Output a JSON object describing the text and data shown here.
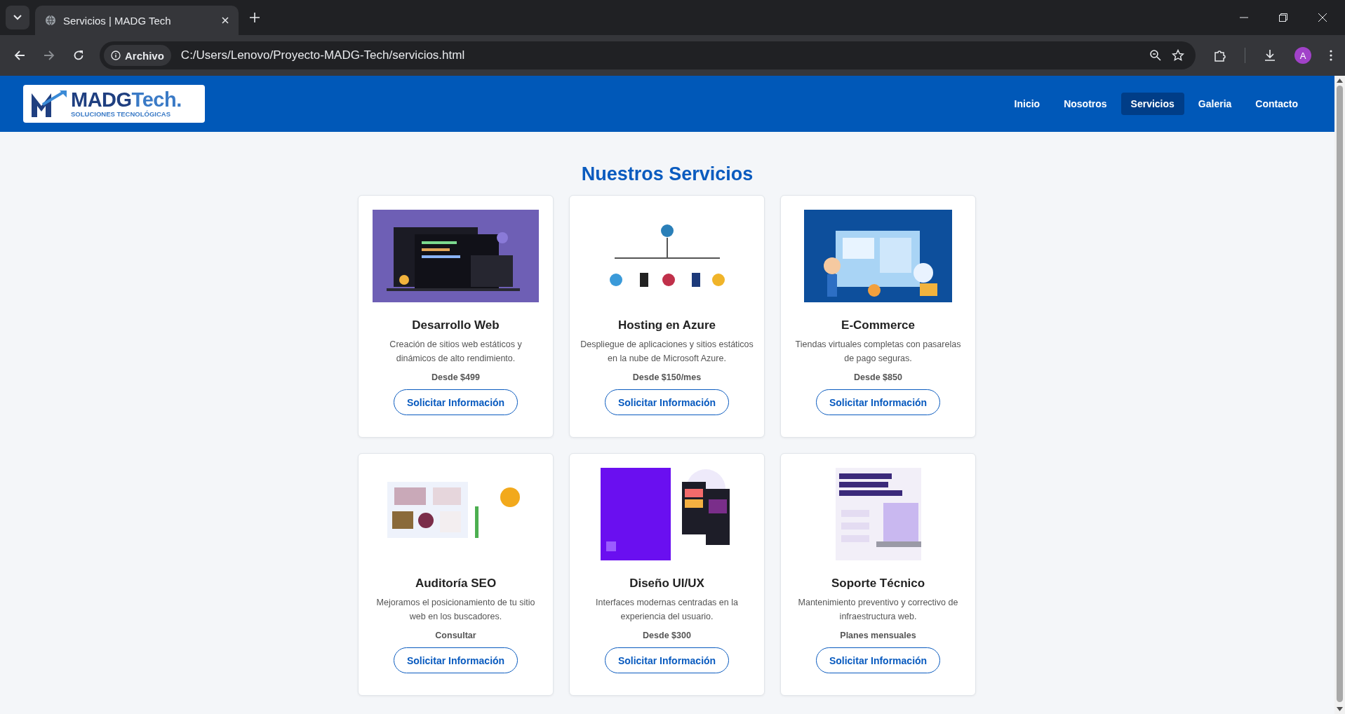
{
  "browser": {
    "tab_title": "Servicios | MADG Tech",
    "site_chip": "Archivo",
    "url": "C:/Users/Lenovo/Proyecto-MADG-Tech/servicios.html",
    "avatar": "A"
  },
  "site": {
    "logo": {
      "name": "MADG",
      "name_accent": "Tech.",
      "tagline": "SOLUCIONES TECNOLÓGICAS"
    },
    "nav": [
      {
        "label": "Inicio",
        "selected": false
      },
      {
        "label": "Nosotros",
        "selected": false
      },
      {
        "label": "Servicios",
        "selected": true
      },
      {
        "label": "Galeria",
        "selected": false
      },
      {
        "label": "Contacto",
        "selected": false
      }
    ]
  },
  "heading": "Nuestros Servicios",
  "services": [
    {
      "title": "Desarrollo Web",
      "description": "Creación de sitios web estáticos y dinámicos de alto rendimiento.",
      "price": "Desde $499",
      "button": "Solicitar Información"
    },
    {
      "title": "Hosting en Azure",
      "description": "Despliegue de aplicaciones y sitios estáticos en la nube de Microsoft Azure.",
      "price": "Desde $150/mes",
      "button": "Solicitar Información"
    },
    {
      "title": "E-Commerce",
      "description": "Tiendas virtuales completas con pasarelas de pago seguras.",
      "price": "Desde $850",
      "button": "Solicitar Información"
    },
    {
      "title": "Auditoría SEO",
      "description": "Mejoramos el posicionamiento de tu sitio web en los buscadores.",
      "price": "Consultar",
      "button": "Solicitar Información"
    },
    {
      "title": "Diseño UI/UX",
      "description": "Interfaces modernas centradas en la experiencia del usuario.",
      "price": "Desde $300",
      "button": "Solicitar Información"
    },
    {
      "title": "Soporte Técnico",
      "description": "Mantenimiento preventivo y correctivo de infraestructura web.",
      "price": "Planes mensuales",
      "button": "Solicitar Información"
    }
  ]
}
